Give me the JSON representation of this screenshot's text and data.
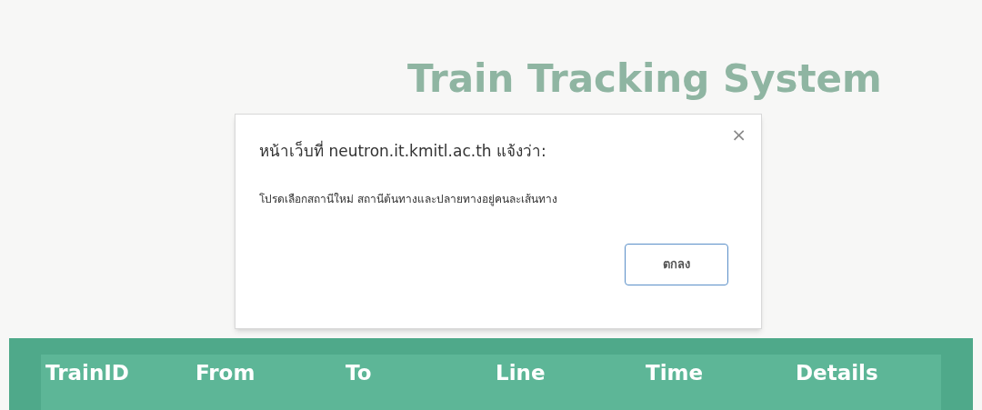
{
  "page": {
    "title": "Train Tracking System"
  },
  "table": {
    "columns": [
      "TrainID",
      "From",
      "To",
      "Line",
      "Time",
      "Details"
    ]
  },
  "dialog": {
    "title": "หน้าเว็บที่ neutron.it.kmitl.ac.th แจ้งว่า:",
    "message": "โปรดเลือกสถานีใหม่ สถานีต้นทางและปลายทางอยู่คนละเส้นทาง",
    "close": "×",
    "buttons": [
      "ตกลง"
    ]
  }
}
